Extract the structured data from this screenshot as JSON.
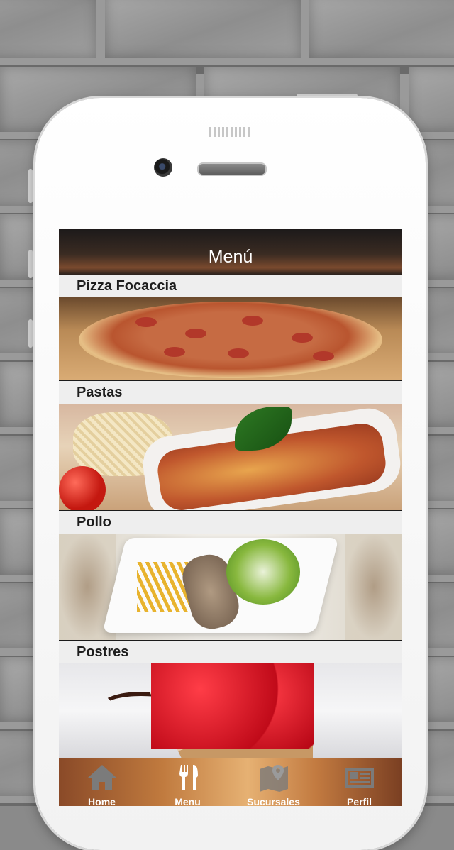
{
  "screen": {
    "title": "Menú"
  },
  "categories": [
    {
      "id": "pizza",
      "label": "Pizza Focaccia",
      "image": "pizza-image"
    },
    {
      "id": "pastas",
      "label": "Pastas",
      "image": "pasta-image"
    },
    {
      "id": "pollo",
      "label": "Pollo",
      "image": "chicken-image"
    },
    {
      "id": "postres",
      "label": "Postres",
      "image": "dessert-image"
    }
  ],
  "tabbar": {
    "items": [
      {
        "label": "Home",
        "icon": "house-icon",
        "active": false
      },
      {
        "label": "Menu",
        "icon": "fork-knife-icon",
        "active": true
      },
      {
        "label": "Sucursales",
        "icon": "map-pin-icon",
        "active": false
      },
      {
        "label": "Perfil",
        "icon": "id-card-icon",
        "active": false
      }
    ]
  },
  "colors": {
    "navbar": "#3a2b22",
    "section_label_bg": "#eeeeee",
    "tabbar_accent": "#c07a3e",
    "tab_inactive_icon": "#7b7b7b",
    "tab_active_icon": "#ffffff"
  }
}
